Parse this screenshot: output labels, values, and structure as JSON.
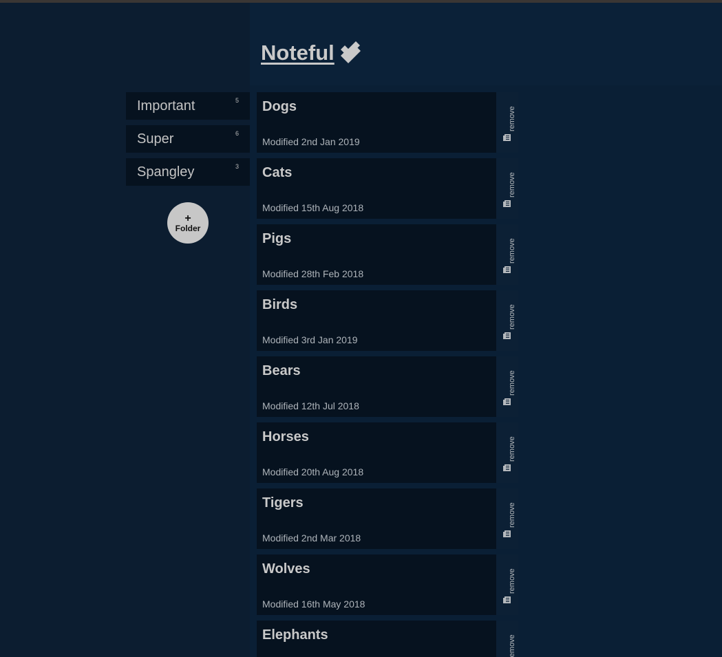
{
  "app": {
    "title": "Noteful"
  },
  "colors": {
    "background": "#0c1d30",
    "header": "#0b2138",
    "item": "#06121f",
    "text": "#c8c8c8",
    "button": "#c7c7c7"
  },
  "sidebar": {
    "folders": [
      {
        "label": "Important",
        "count": "5"
      },
      {
        "label": "Super",
        "count": "6"
      },
      {
        "label": "Spangley",
        "count": "3"
      }
    ],
    "add_button": {
      "plus": "+",
      "label": "Folder"
    }
  },
  "notes": [
    {
      "title": "Dogs",
      "modified": "Modified 2nd Jan 2019",
      "remove": "remove"
    },
    {
      "title": "Cats",
      "modified": "Modified 15th Aug 2018",
      "remove": "remove"
    },
    {
      "title": "Pigs",
      "modified": "Modified 28th Feb 2018",
      "remove": "remove"
    },
    {
      "title": "Birds",
      "modified": "Modified 3rd Jan 2019",
      "remove": "remove"
    },
    {
      "title": "Bears",
      "modified": "Modified 12th Jul 2018",
      "remove": "remove"
    },
    {
      "title": "Horses",
      "modified": "Modified 20th Aug 2018",
      "remove": "remove"
    },
    {
      "title": "Tigers",
      "modified": "Modified 2nd Mar 2018",
      "remove": "remove"
    },
    {
      "title": "Wolves",
      "modified": "Modified 16th May 2018",
      "remove": "remove"
    },
    {
      "title": "Elephants",
      "modified": "",
      "remove": "remove"
    }
  ]
}
